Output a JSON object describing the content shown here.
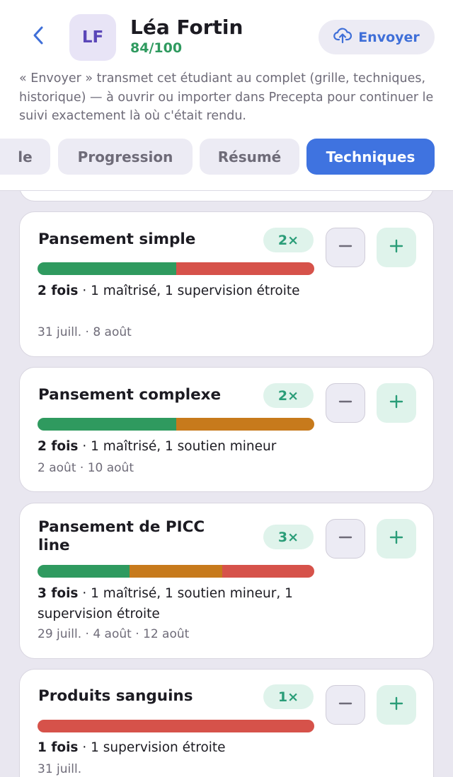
{
  "header": {
    "back_label": "‹",
    "avatar_initials": "LF",
    "student_name": "Léa Fortin",
    "score": "84/100",
    "send_label": "Envoyer",
    "description": "« Envoyer » transmet cet étudiant au complet (grille, techniques, historique) — à ouvrir ou importer dans Precepta pour continuer le suivi exactement là où c'était rendu."
  },
  "tabs": [
    {
      "label": "le",
      "active": false
    },
    {
      "label": "Progression",
      "active": false
    },
    {
      "label": "Résumé",
      "active": false
    },
    {
      "label": "Techniques",
      "active": true
    }
  ],
  "colors": {
    "mastered": "#2f9a5f",
    "minor_support": "#c77a1c",
    "close_supervision": "#d6524a",
    "accent": "#3f73e0"
  },
  "cards": [
    {
      "title": "Pansement simple",
      "count": "2×",
      "summary_bold": "2 fois",
      "summary_rest": " · 1 maîtrisé, 1 supervision étroite",
      "dates": "31 juill. · 8 août",
      "segments": [
        "mastered",
        "close_supervision"
      ]
    },
    {
      "title": "Pansement complexe",
      "count": "2×",
      "summary_bold": "2 fois",
      "summary_rest": " · 1 maîtrisé, 1 soutien mineur",
      "dates": "2 août · 10 août",
      "segments": [
        "mastered",
        "minor_support"
      ]
    },
    {
      "title": "Pansement de PICC line",
      "count": "3×",
      "summary_bold": "3 fois",
      "summary_rest": " · 1 maîtrisé, 1 soutien mineur, 1 supervision étroite",
      "dates": "29 juill. · 4 août · 12 août",
      "segments": [
        "mastered",
        "minor_support",
        "close_supervision"
      ]
    },
    {
      "title": "Produits sanguins",
      "count": "1×",
      "summary_bold": "1 fois",
      "summary_rest": " · 1 supervision étroite",
      "dates": "31 juill.",
      "segments": [
        "close_supervision"
      ]
    }
  ]
}
